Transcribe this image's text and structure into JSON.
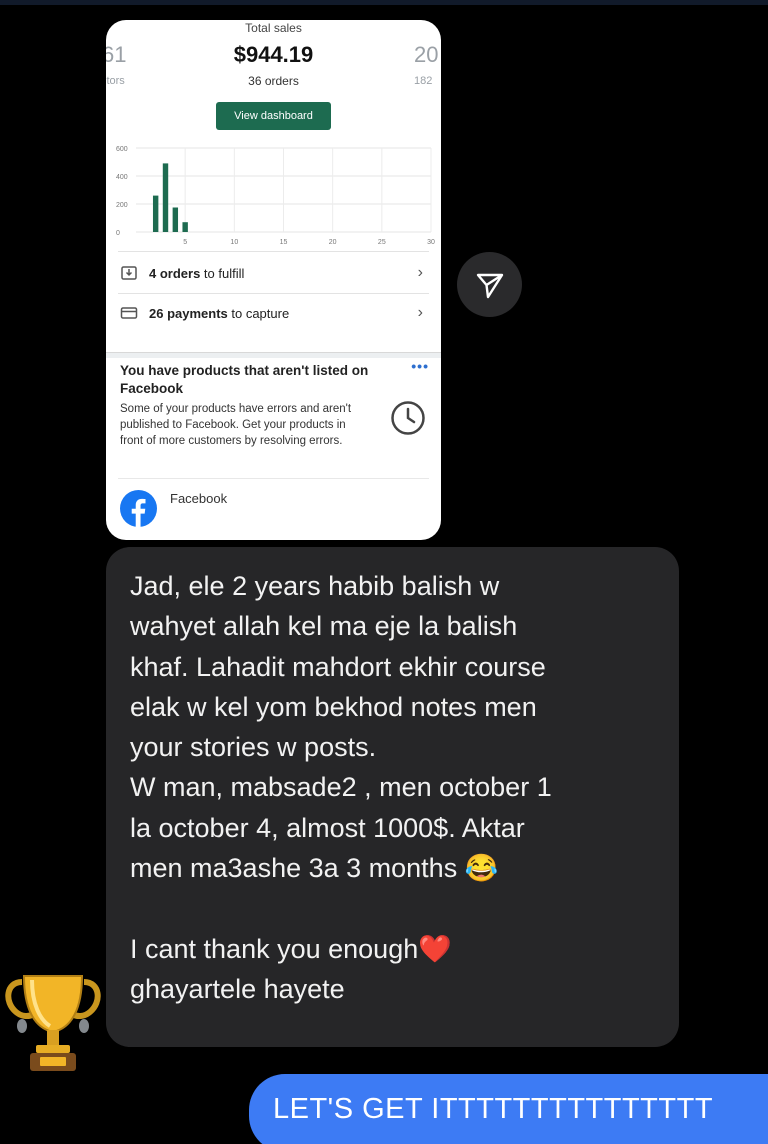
{
  "card": {
    "left_stat_value": "61",
    "left_stat_label": "itors",
    "sales_label": "Total sales",
    "sales_value": "$944.19",
    "orders_label": "36 orders",
    "right_stat_value": "20",
    "right_stat_sub": "182",
    "dashboard_button": "View dashboard",
    "fulfill_count": "4 orders",
    "fulfill_rest": " to fulfill",
    "capture_count": "26 payments",
    "capture_rest": " to capture",
    "fb_title": "You have products that aren't listed on Facebook",
    "fb_body": "Some of your products have errors and aren't published to Facebook. Get your products in front of more customers by resolving errors.",
    "fb_channel": "Facebook",
    "more_icon": "more-dots-icon",
    "accent_green": "#1d6b50",
    "facebook_blue": "#1877f2"
  },
  "chart_data": {
    "type": "bar",
    "x": [
      2,
      3,
      4,
      5
    ],
    "values": [
      260,
      490,
      175,
      70
    ],
    "xlim": [
      0,
      30
    ],
    "ylim": [
      0,
      600
    ],
    "x_ticks": [
      "5",
      "10",
      "15",
      "20",
      "25",
      "30"
    ],
    "y_ticks": [
      "0",
      "200",
      "400",
      "600"
    ],
    "bar_color": "#1d6b50",
    "grid": true
  },
  "message": {
    "text": "Jad, ele 2 years habib balish w\nwahyet allah kel ma eje la balish\nkhaf. Lahadit mahdort ekhir course\nelak w kel yom bekhod notes men\nyour stories w posts.\nW man, mabsade2 , men october 1\nla october 4, almost 1000$. Aktar\nmen ma3ashe 3a 3 months 😂\n\nI cant thank you enough❤️\nghayartele hayete",
    "bubble_color": "#262628",
    "reaction": "trophy-icon"
  },
  "reply": {
    "text": "LET'S GET ITTTTTTTTTTTTTTT",
    "bubble_color": "#3d7bf4"
  },
  "send_icon": "send-icon"
}
